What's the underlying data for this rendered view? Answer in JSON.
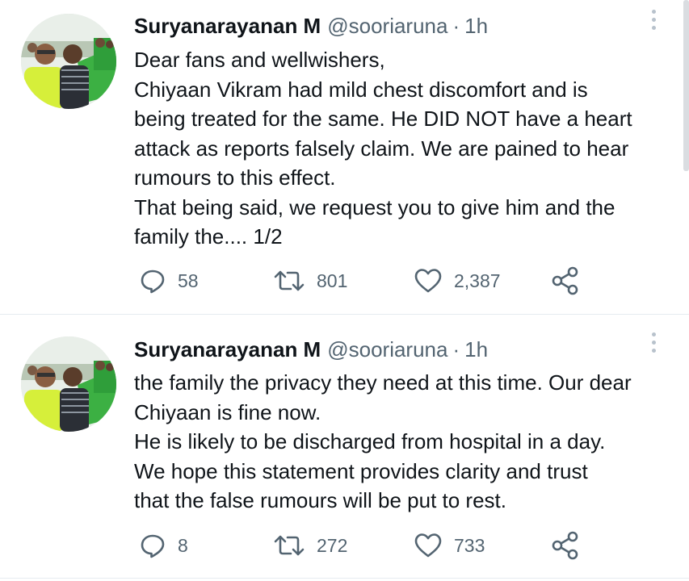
{
  "colors": {
    "text": "#0f1419",
    "secondary": "#536471",
    "divider": "#e6ecf0"
  },
  "tweets": [
    {
      "author_name": "Suryanarayanan M",
      "handle": "@sooriaruna",
      "separator": "·",
      "time": "1h",
      "lines": [
        "Dear fans and wellwishers,",
        "Chiyaan Vikram had mild chest discomfort and is",
        "being treated for the same. He DID NOT have a heart",
        "attack as reports falsely claim. We are pained to hear",
        "rumours to this effect.",
        "That being said, we request you to give him and the",
        "family the.... 1/2"
      ],
      "replies": "58",
      "retweets": "801",
      "likes": "2,387"
    },
    {
      "author_name": "Suryanarayanan M",
      "handle": "@sooriaruna",
      "separator": "·",
      "time": "1h",
      "lines": [
        "the family the privacy they need at this time. Our dear",
        "Chiyaan is fine now.",
        "He is likely to be discharged from hospital in a day.",
        "We hope this statement provides clarity and trust",
        "that the false rumours will be put to rest."
      ],
      "replies": "8",
      "retweets": "272",
      "likes": "733"
    }
  ],
  "icons": {
    "avatar": "profile-photo",
    "more": "more-vertical-icon",
    "reply": "reply-icon",
    "retweet": "retweet-icon",
    "like": "heart-icon",
    "share": "share-icon"
  }
}
